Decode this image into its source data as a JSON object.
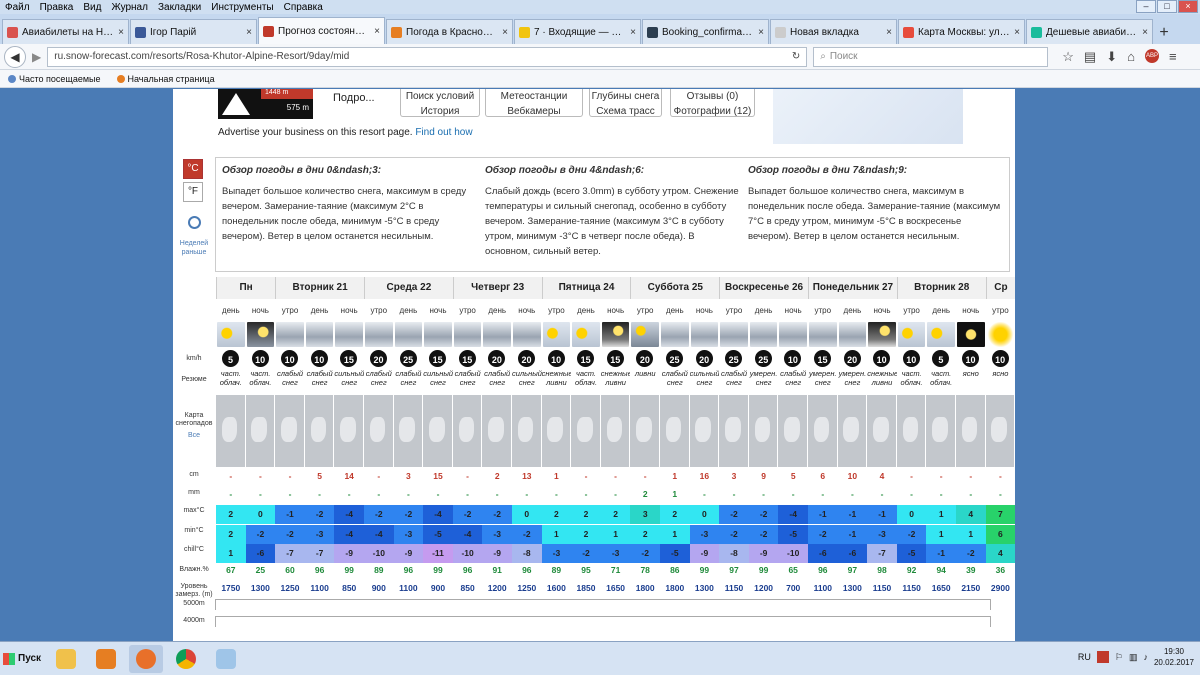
{
  "window": {
    "menu": [
      "Файл",
      "Правка",
      "Вид",
      "Журнал",
      "Закладки",
      "Инструменты",
      "Справка"
    ]
  },
  "tabs": [
    {
      "label": "Авиабилеты на Нов...",
      "color": "#d9534f"
    },
    {
      "label": "Ігор Парій",
      "color": "#3b5998"
    },
    {
      "label": "Прогноз состояния ...",
      "color": "#c0392b",
      "active": true
    },
    {
      "label": "Погода в Красной П...",
      "color": "#e67e22"
    },
    {
      "label": "7 · Входящие — Ян...",
      "color": "#f1c40f"
    },
    {
      "label": "Booking_confirmatio...",
      "color": "#2c3e50"
    },
    {
      "label": "Новая вкладка",
      "color": "#cccccc"
    },
    {
      "label": "Карта Москвы: ули...",
      "color": "#e74c3c"
    },
    {
      "label": "Дешевые авиабиле...",
      "color": "#1abc9c"
    }
  ],
  "nav": {
    "url": "ru.snow-forecast.com/resorts/Rosa-Khutor-Alpine-Resort/9day/mid",
    "search_placeholder": "Поиск"
  },
  "bookmarks": [
    "Часто посещаемые",
    "Начальная страница"
  ],
  "resort": {
    "elev_top": "1448 m",
    "elev_bottom": "575 m",
    "more_label": "Подро...",
    "buttons": [
      {
        "top": "Поиск условий",
        "bottom": "История"
      },
      {
        "top": "Метеостанции",
        "bottom": "Вебкамеры"
      },
      {
        "top": "Глубины снега",
        "bottom": "Схема трасс"
      },
      {
        "top": "Отзывы (0)",
        "bottom": "Фотографии (12)"
      }
    ],
    "ad_text": "Advertise your business on this resort page.",
    "ad_link": "Find out how"
  },
  "units": {
    "c": "°C",
    "f": "°F",
    "earlier": "Неделей раньше"
  },
  "overview": [
    {
      "title": "Обзор погоды в дни 0&ndash;3:",
      "text": "Выпадет большое количество снега, максимум в среду вечером. Замерание-таяние (максимум 2°C в понедельник после обеда, минимум -5°C в среду вечером). Ветер в целом останется несильным."
    },
    {
      "title": "Обзор погоды в дни 4&ndash;6:",
      "text": "Слабый дождь (всего 3.0mm) в субботу утром. Снежение температуры и сильный снегопад, особенно в субботу вечером. Замерание-таяние (максимум 3°C в субботу утром, минимум -3°C в четверг после обеда). В основном, сильный ветер."
    },
    {
      "title": "Обзор погоды в дни 7&ndash;9:",
      "text": "Выпадет большое количество снега, максимум в понедельник после обеда. Замерание-таяние (максимум 7°C в среду утром, минимум -5°C в воскресенье вечером). Ветер в целом останется несильным."
    }
  ],
  "row_labels": {
    "wind": "km/h",
    "summary": "Резюме",
    "map": "Карта снегопадов",
    "map_all": "Все",
    "snow": "cm",
    "rain": "mm",
    "max": "max°C",
    "min": "min°C",
    "chill": "chill°C",
    "hum": "Влажн.%",
    "freeze": "Уровень замерз. (m)",
    "lvl5": "5000m",
    "lvl4": "4000m"
  },
  "days": [
    {
      "name": "Пн",
      "periods": [
        {
          "phase": "день",
          "icon": "sun-cloud",
          "wind": "5",
          "summary": "част. облач.",
          "snow": "-",
          "rain": "-",
          "max": "2",
          "min": "2",
          "chill": "1",
          "hum": "67",
          "freeze": "1750"
        },
        {
          "phase": "ночь",
          "icon": "moon-cloud",
          "wind": "10",
          "summary": "част. облач.",
          "snow": "-",
          "rain": "-",
          "max": "0",
          "min": "-2",
          "chill": "-6",
          "hum": "25",
          "freeze": "1300"
        }
      ]
    },
    {
      "name": "Вторник 21",
      "periods": [
        {
          "phase": "утро",
          "icon": "snow",
          "wind": "10",
          "summary": "слабый снег",
          "snow": "-",
          "rain": "-",
          "max": "-1",
          "min": "-2",
          "chill": "-7",
          "hum": "60",
          "freeze": "1250"
        },
        {
          "phase": "день",
          "icon": "snow",
          "wind": "10",
          "summary": "слабый снег",
          "snow": "5",
          "rain": "-",
          "max": "-2",
          "min": "-3",
          "chill": "-7",
          "hum": "96",
          "freeze": "1100"
        },
        {
          "phase": "ночь",
          "icon": "snow",
          "wind": "15",
          "summary": "сильный снег",
          "snow": "14",
          "rain": "-",
          "max": "-4",
          "min": "-4",
          "chill": "-9",
          "hum": "99",
          "freeze": "850"
        }
      ]
    },
    {
      "name": "Среда 22",
      "periods": [
        {
          "phase": "утро",
          "icon": "snow",
          "wind": "20",
          "summary": "слабый снег",
          "snow": "-",
          "rain": "-",
          "max": "-2",
          "min": "-4",
          "chill": "-10",
          "hum": "89",
          "freeze": "900"
        },
        {
          "phase": "день",
          "icon": "snow",
          "wind": "25",
          "summary": "слабый снег",
          "snow": "3",
          "rain": "-",
          "max": "-2",
          "min": "-3",
          "chill": "-9",
          "hum": "96",
          "freeze": "1100"
        },
        {
          "phase": "ночь",
          "icon": "snow",
          "wind": "15",
          "summary": "сильный снег",
          "snow": "15",
          "rain": "-",
          "max": "-4",
          "min": "-5",
          "chill": "-11",
          "hum": "99",
          "freeze": "900"
        }
      ]
    },
    {
      "name": "Четверг 23",
      "periods": [
        {
          "phase": "утро",
          "icon": "snow",
          "wind": "15",
          "summary": "слабый снег",
          "snow": "-",
          "rain": "-",
          "max": "-2",
          "min": "-4",
          "chill": "-10",
          "hum": "96",
          "freeze": "850"
        },
        {
          "phase": "день",
          "icon": "snow",
          "wind": "20",
          "summary": "слабый снег",
          "snow": "2",
          "rain": "-",
          "max": "-2",
          "min": "-3",
          "chill": "-9",
          "hum": "91",
          "freeze": "1200"
        },
        {
          "phase": "ночь",
          "icon": "snow",
          "wind": "20",
          "summary": "сильный снег",
          "snow": "13",
          "rain": "-",
          "max": "0",
          "min": "-2",
          "chill": "-8",
          "hum": "96",
          "freeze": "1250"
        }
      ]
    },
    {
      "name": "Пятница 24",
      "periods": [
        {
          "phase": "утро",
          "icon": "sun-cloud",
          "wind": "10",
          "summary": "снежные ливни",
          "snow": "1",
          "rain": "-",
          "max": "2",
          "min": "1",
          "chill": "-3",
          "hum": "89",
          "freeze": "1600"
        },
        {
          "phase": "день",
          "icon": "sun-cloud",
          "wind": "15",
          "summary": "част. облач.",
          "snow": "-",
          "rain": "-",
          "max": "2",
          "min": "2",
          "chill": "-2",
          "hum": "95",
          "freeze": "1850"
        },
        {
          "phase": "ночь",
          "icon": "moon-snow",
          "wind": "15",
          "summary": "снежные ливни",
          "snow": "-",
          "rain": "-",
          "max": "2",
          "min": "1",
          "chill": "-3",
          "hum": "71",
          "freeze": "1650"
        }
      ]
    },
    {
      "name": "Суббота 25",
      "periods": [
        {
          "phase": "утро",
          "icon": "rain",
          "wind": "20",
          "summary": "ливни",
          "snow": "-",
          "rain": "2",
          "max": "3",
          "min": "2",
          "chill": "-2",
          "hum": "78",
          "freeze": "1800"
        },
        {
          "phase": "день",
          "icon": "snow",
          "wind": "25",
          "summary": "слабый снег",
          "snow": "1",
          "rain": "1",
          "max": "2",
          "min": "1",
          "chill": "-5",
          "hum": "86",
          "freeze": "1800"
        },
        {
          "phase": "ночь",
          "icon": "snow",
          "wind": "20",
          "summary": "сильный снег",
          "snow": "16",
          "rain": "-",
          "max": "0",
          "min": "-3",
          "chill": "-9",
          "hum": "99",
          "freeze": "1300"
        }
      ]
    },
    {
      "name": "Воскресенье 26",
      "periods": [
        {
          "phase": "утро",
          "icon": "snow",
          "wind": "25",
          "summary": "слабый снег",
          "snow": "3",
          "rain": "-",
          "max": "-2",
          "min": "-2",
          "chill": "-8",
          "hum": "97",
          "freeze": "1150"
        },
        {
          "phase": "день",
          "icon": "snow",
          "wind": "25",
          "summary": "умерен. снег",
          "snow": "9",
          "rain": "-",
          "max": "-2",
          "min": "-2",
          "chill": "-9",
          "hum": "99",
          "freeze": "1200"
        },
        {
          "phase": "ночь",
          "icon": "snow",
          "wind": "10",
          "summary": "слабый снег",
          "snow": "5",
          "rain": "-",
          "max": "-4",
          "min": "-5",
          "chill": "-10",
          "hum": "65",
          "freeze": "700"
        }
      ]
    },
    {
      "name": "Понедельник 27",
      "periods": [
        {
          "phase": "утро",
          "icon": "snow",
          "wind": "15",
          "summary": "умерен. снег",
          "snow": "6",
          "rain": "-",
          "max": "-1",
          "min": "-2",
          "chill": "-6",
          "hum": "96",
          "freeze": "1100"
        },
        {
          "phase": "день",
          "icon": "snow",
          "wind": "20",
          "summary": "умерен. снег",
          "snow": "10",
          "rain": "-",
          "max": "-1",
          "min": "-1",
          "chill": "-6",
          "hum": "97",
          "freeze": "1300"
        },
        {
          "phase": "ночь",
          "icon": "moon-snow",
          "wind": "10",
          "summary": "снежные ливни",
          "snow": "4",
          "rain": "-",
          "max": "-1",
          "min": "-3",
          "chill": "-7",
          "hum": "98",
          "freeze": "1150"
        }
      ]
    },
    {
      "name": "Вторник 28",
      "periods": [
        {
          "phase": "утро",
          "icon": "sun-cloud",
          "wind": "10",
          "summary": "част. облач.",
          "snow": "-",
          "rain": "-",
          "max": "0",
          "min": "-2",
          "chill": "-5",
          "hum": "92",
          "freeze": "1150"
        },
        {
          "phase": "день",
          "icon": "sun-cloud",
          "wind": "5",
          "summary": "част. облач.",
          "snow": "-",
          "rain": "-",
          "max": "1",
          "min": "1",
          "chill": "-1",
          "hum": "94",
          "freeze": "1650"
        },
        {
          "phase": "ночь",
          "icon": "moon",
          "wind": "10",
          "summary": "ясно",
          "snow": "-",
          "rain": "-",
          "max": "4",
          "min": "1",
          "chill": "-2",
          "hum": "39",
          "freeze": "2150"
        }
      ]
    },
    {
      "name": "Ср",
      "periods": [
        {
          "phase": "утро",
          "icon": "sun",
          "wind": "10",
          "summary": "ясно",
          "snow": "-",
          "rain": "-",
          "max": "7",
          "min": "6",
          "chill": "4",
          "hum": "36",
          "freeze": "2900"
        }
      ]
    }
  ],
  "taskbar": {
    "start_label": "Пуск",
    "lang": "RU",
    "time": "19:30",
    "date": "20.02.2017"
  },
  "colors": {
    "accent": "#c0392b",
    "link": "#1a6eb0",
    "page_bg": "#4a7bb5"
  }
}
